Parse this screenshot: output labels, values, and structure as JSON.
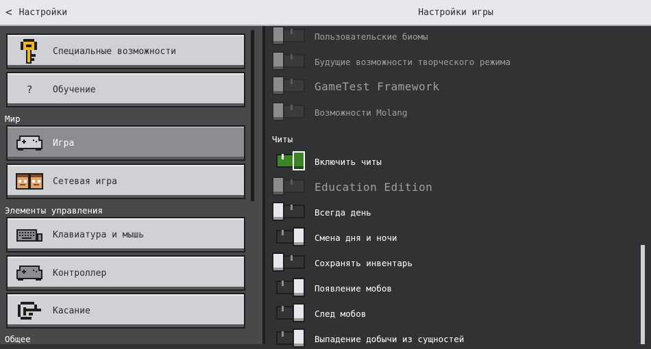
{
  "header": {
    "back_label": "Настройки",
    "title": "Настройки игры"
  },
  "sidebar": {
    "buttons": [
      {
        "label": "Специальные возможности",
        "icon": "key-icon"
      },
      {
        "label": "Обучение",
        "icon": "question-mark-icon",
        "glyph": "?"
      },
      {
        "label": "Игра",
        "icon": "gamepad-icon",
        "active": true
      },
      {
        "label": "Сетевая игра",
        "icon": "players-icon"
      },
      {
        "label": "Клавиатура и мышь",
        "icon": "keyboard-icon"
      },
      {
        "label": "Контроллер",
        "icon": "controller-icon"
      },
      {
        "label": "Касание",
        "icon": "touch-hand-icon"
      }
    ],
    "sections": {
      "world": "Мир",
      "controls": "Элементы управления",
      "general": "Общее"
    }
  },
  "settings": {
    "experimental": [
      {
        "label": "Пользовательские биомы",
        "state": "off",
        "disabled": true
      },
      {
        "label": "Будущие возможности творческого режима",
        "state": "off",
        "disabled": true
      },
      {
        "label": "GameTest Framework",
        "state": "off",
        "disabled": true
      },
      {
        "label": "Возможности Molang",
        "state": "off",
        "disabled": true
      }
    ],
    "cheats_section": "Читы",
    "cheats": [
      {
        "label": "Включить читы",
        "state": "on",
        "focused": true
      },
      {
        "label": "Education Edition",
        "state": "off",
        "disabled": true
      },
      {
        "label": "Всегда день",
        "state": "off"
      },
      {
        "label": "Смена дня и ночи",
        "state": "on"
      },
      {
        "label": "Сохранять инвентарь",
        "state": "off"
      },
      {
        "label": "Появление мобов",
        "state": "on"
      },
      {
        "label": "След мобов",
        "state": "on"
      },
      {
        "label": "Выпадение добычи из сущностей",
        "state": "on"
      }
    ]
  },
  "colors": {
    "header_bg": "#e6e8eb",
    "panel_bg": "#313233",
    "sidebar_bg": "#48494a",
    "button_bg": "#d0d1d4",
    "active_button_bg": "#8c8d90",
    "toggle_on": "#3c8527"
  }
}
